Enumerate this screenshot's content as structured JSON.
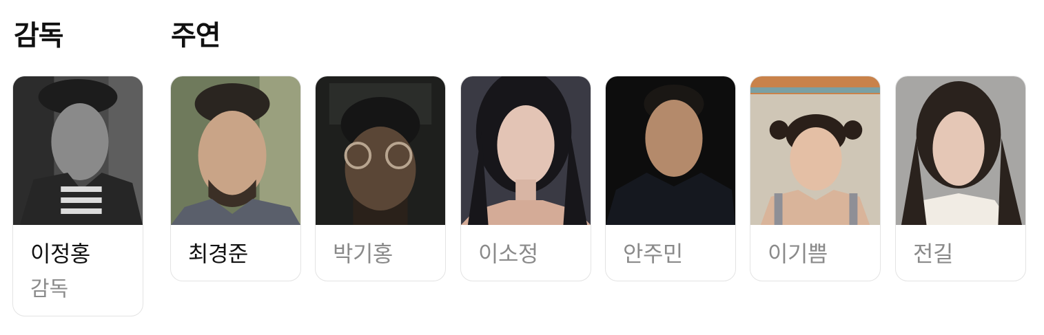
{
  "sections": {
    "director_title": "감독",
    "cast_title": "주연"
  },
  "director": {
    "name": "이정홍",
    "role": "감독"
  },
  "cast": [
    {
      "name": "최경준"
    },
    {
      "name": "박기홍"
    },
    {
      "name": "이소정"
    },
    {
      "name": "안주민"
    },
    {
      "name": "이기쁨"
    },
    {
      "name": "전길"
    }
  ],
  "colors": {
    "text_primary": "#111111",
    "text_muted": "#8a8a8a",
    "card_border": "#e3e3e3"
  }
}
